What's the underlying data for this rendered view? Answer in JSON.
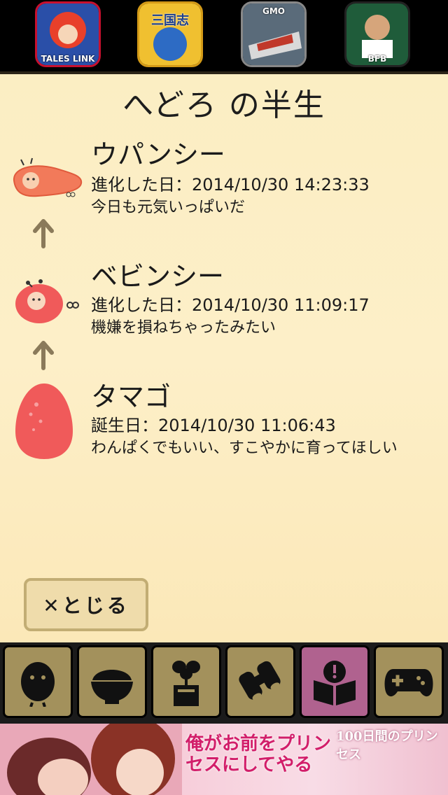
{
  "top_ads": [
    {
      "name": "tales-of-link-app-icon",
      "label": "TALES LINK",
      "color": "#e8402a"
    },
    {
      "name": "sangokushi-app-icon",
      "label": "三国志",
      "color": "#f0c030"
    },
    {
      "name": "gmo-racing-app-icon",
      "label": "GMO",
      "color": "#c0392b"
    },
    {
      "name": "bfb-soccer-app-icon",
      "label": "BFB",
      "color": "#3a7bd5"
    }
  ],
  "page": {
    "title": "へどろ の半生"
  },
  "history": [
    {
      "name": "ウパンシー",
      "date": "進化した日：2014/10/30  14:23:33",
      "message": "今日も元気いっぱいだ"
    },
    {
      "name": "ベビンシー",
      "date": "進化した日：2014/10/30  11:09:17",
      "message": "機嫌を損ねちゃったみたい"
    },
    {
      "name": "タマゴ",
      "date": "誕生日：2014/10/30  11:06:43",
      "message": "わんぱくでもいい、すこやかに育ってほしい"
    }
  ],
  "close_button": {
    "label": "✕とじる"
  },
  "tabs": [
    {
      "name": "character-tab",
      "icon": "character-icon"
    },
    {
      "name": "food-tab",
      "icon": "rice-bowl-icon"
    },
    {
      "name": "plant-tab",
      "icon": "sprout-icon"
    },
    {
      "name": "explore-tab",
      "icon": "binoculars-icon"
    },
    {
      "name": "book-tab",
      "icon": "book-icon",
      "active": true
    },
    {
      "name": "game-tab",
      "icon": "gamepad-icon"
    }
  ],
  "bottom_ad": {
    "text": "俺がお前をプリンセスにしてやる",
    "logo": "100日間のプリンセス"
  },
  "colors": {
    "parchment": "#fdefc8",
    "tab": "#a3915c",
    "tab_active": "#b0628f",
    "egg": "#f05a5a"
  }
}
